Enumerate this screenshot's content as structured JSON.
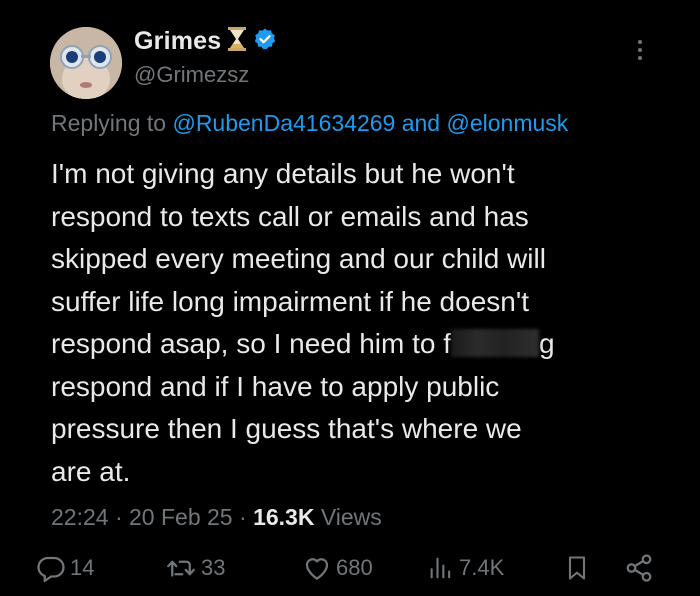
{
  "author": {
    "display_name": "Grimes",
    "handle": "@Grimezsz",
    "emoji": "hourglass",
    "verified": true,
    "badge_color": "#1d9bf0"
  },
  "reply": {
    "prefix": "Replying to",
    "mention_1": "@RubenDa41634269",
    "joiner": "and",
    "mention_2": "@elonmusk"
  },
  "tweet": {
    "lines": [
      "I'm not giving any details but he won't",
      "respond to texts call or emails and has",
      "skipped every meeting and our child will",
      "suffer life long impairment if he doesn't",
      "respond asap, so I need him to f",
      "respond and if I have to apply public",
      "pressure then I guess that's where we",
      "are at."
    ],
    "line5_after_censor": "g"
  },
  "meta": {
    "time": "22:24",
    "date": "20 Feb 25",
    "views_count": "16.3K",
    "views_label": "Views"
  },
  "actions": {
    "replies": "14",
    "retweets": "33",
    "likes": "680",
    "views": "7.4K"
  },
  "colors": {
    "background": "#000000",
    "text": "#e7e9ea",
    "secondary": "#71767b",
    "link": "#1d9bf0"
  }
}
